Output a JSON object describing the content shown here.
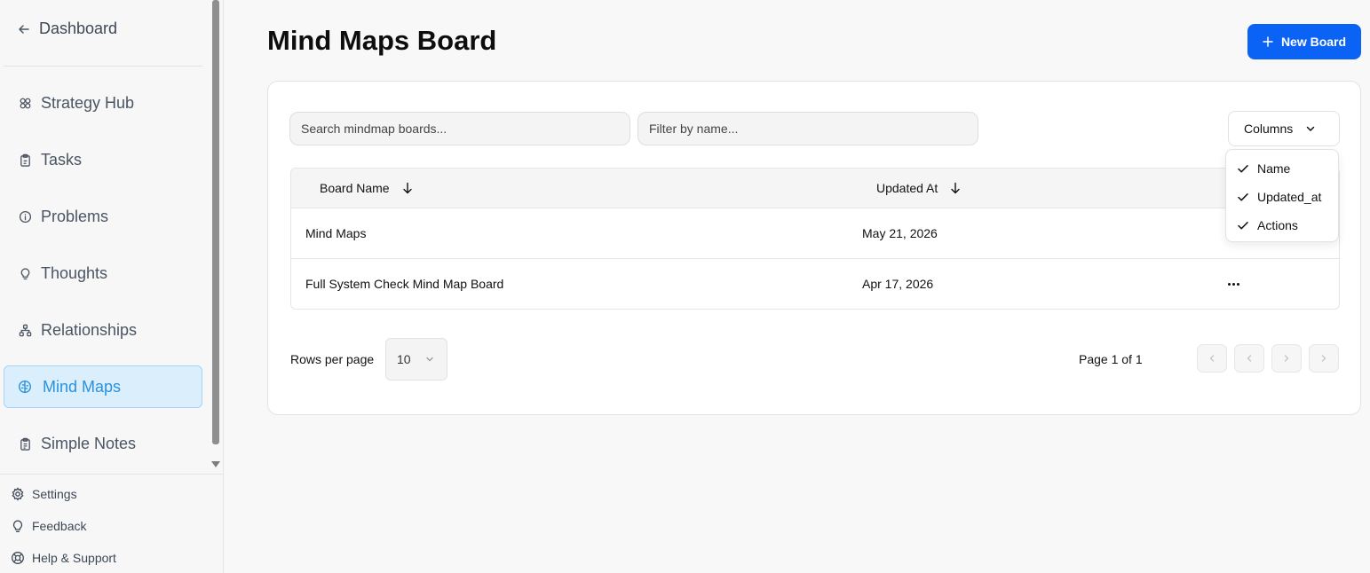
{
  "sidebar": {
    "back_label": "Dashboard",
    "items": [
      {
        "label": "Strategy Hub",
        "icon": "strategy-hub-icon"
      },
      {
        "label": "Tasks",
        "icon": "clipboard-icon"
      },
      {
        "label": "Problems",
        "icon": "info-icon"
      },
      {
        "label": "Thoughts",
        "icon": "lightbulb-icon"
      },
      {
        "label": "Relationships",
        "icon": "network-icon"
      },
      {
        "label": "Mind Maps",
        "icon": "brain-icon",
        "active": true
      },
      {
        "label": "Simple Notes",
        "icon": "clipboard-list-icon"
      }
    ],
    "footer": [
      {
        "label": "Settings",
        "icon": "gear-icon"
      },
      {
        "label": "Feedback",
        "icon": "lightbulb-icon"
      },
      {
        "label": "Help & Support",
        "icon": "lifebuoy-icon"
      }
    ]
  },
  "main": {
    "title": "Mind Maps Board",
    "new_board_label": "New Board",
    "search_placeholder": "Search mindmap boards...",
    "filter_placeholder": "Filter by name...",
    "columns_label": "Columns",
    "columns_menu": [
      "Name",
      "Updated_at",
      "Actions"
    ],
    "table": {
      "headers": [
        "Board Name",
        "Updated At"
      ],
      "rows": [
        {
          "name": "Mind Maps",
          "updated": "May 21, 2026"
        },
        {
          "name": "Full System Check Mind Map Board",
          "updated": "Apr 17, 2026"
        }
      ]
    },
    "pagination": {
      "rows_per_page_label": "Rows per page",
      "rows_per_page_value": "10",
      "page_info": "Page 1 of 1"
    }
  },
  "colors": {
    "accent": "#0b63f5",
    "active_nav_bg": "#dbeefc",
    "active_nav_text": "#2a91de"
  }
}
